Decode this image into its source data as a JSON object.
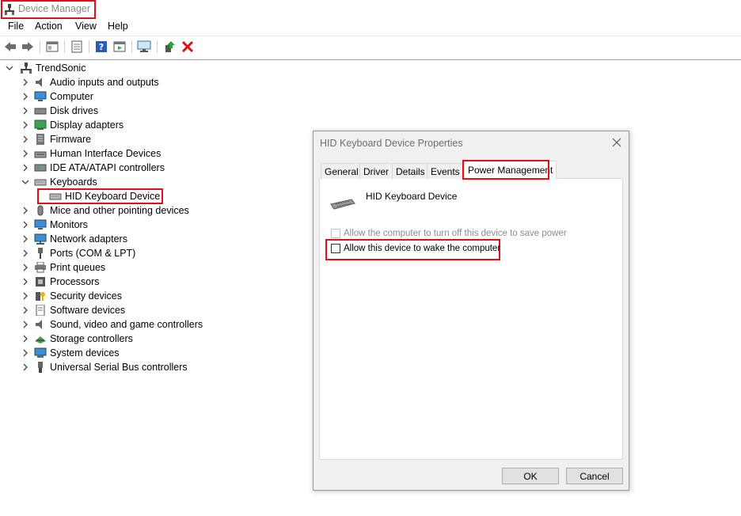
{
  "window": {
    "title": "Device Manager"
  },
  "menu": [
    "File",
    "Action",
    "View",
    "Help"
  ],
  "toolbar": {
    "icons": [
      "back-arrow",
      "forward-arrow",
      "show-hide-tree",
      "properties",
      "help",
      "action-pane",
      "scan-hardware",
      "enable-device",
      "uninstall-device"
    ]
  },
  "tree": {
    "root": "TrendSonic",
    "categories": [
      "Audio inputs and outputs",
      "Computer",
      "Disk drives",
      "Display adapters",
      "Firmware",
      "Human Interface Devices",
      "IDE ATA/ATAPI controllers",
      "Keyboards",
      "Mice and other pointing devices",
      "Monitors",
      "Network adapters",
      "Ports (COM & LPT)",
      "Print queues",
      "Processors",
      "Security devices",
      "Software devices",
      "Sound, video and game controllers",
      "Storage controllers",
      "System devices",
      "Universal Serial Bus controllers"
    ],
    "keyboard_child": "HID Keyboard Device",
    "expanded": "Keyboards"
  },
  "dialog": {
    "title": "HID Keyboard Device Properties",
    "tabs": [
      "General",
      "Driver",
      "Details",
      "Events",
      "Power Management"
    ],
    "active_tab": "Power Management",
    "device_name": "HID Keyboard Device",
    "option1": "Allow the computer to turn off this device to save power",
    "option1_checked": false,
    "option1_enabled": false,
    "option2": "Allow this device to wake the computer",
    "option2_checked": false,
    "ok": "OK",
    "cancel": "Cancel"
  },
  "colors": {
    "highlight": "#e0101b",
    "dialog_bg": "#f0f0f0"
  }
}
